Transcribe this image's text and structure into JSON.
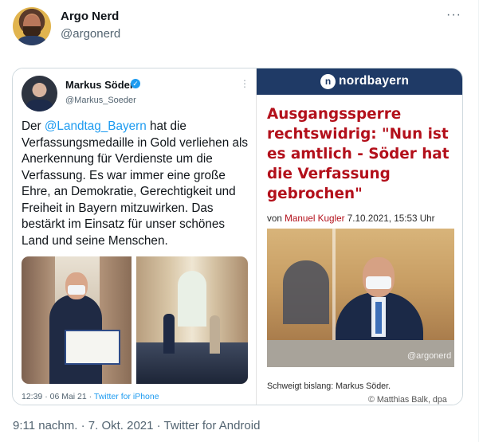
{
  "author": {
    "name": "Argo Nerd",
    "handle": "@argonerd"
  },
  "more_label": "···",
  "quoted_tweet": {
    "name": "Markus Söder",
    "handle": "@Markus_Soeder",
    "verified_icon": "✓",
    "more_label": "⋮",
    "text_before": "Der ",
    "mention": "@Landtag_Bayern",
    "text_after": " hat die Verfassungsmedaille in Gold verliehen als Anerkennung für Verdienste um die Verfassung. Es war immer eine große Ehre, an Demokratie, Gerechtigkeit und Freiheit in Bayern mitzuwirken. Das bestärkt im Einsatz für unser schönes Land und seine Menschen.",
    "timestamp": "12:39 · 06 Mai 21 · ",
    "source": "Twitter for iPhone"
  },
  "article": {
    "logo_letter": "n",
    "brand": "nordbayern",
    "headline": "Ausgangssperre rechtswidrig: \"Nun ist es amtlich - Söder hat die Verfassung gebrochen\"",
    "byline_prefix": "von ",
    "author": "Manuel Kugler",
    "date": "  7.10.2021, 15:53 Uhr",
    "watermark": "@argonerd",
    "caption": "Schweigt bislang: Markus Söder.",
    "credit": "© Matthias Balk, dpa"
  },
  "meta": "9:11 nachm. · 7. Okt. 2021 · Twitter for Android",
  "colors": {
    "link_blue": "#1d9bf0",
    "headline_red": "#b3101b",
    "nordbayern_navy": "#1f3a66"
  }
}
